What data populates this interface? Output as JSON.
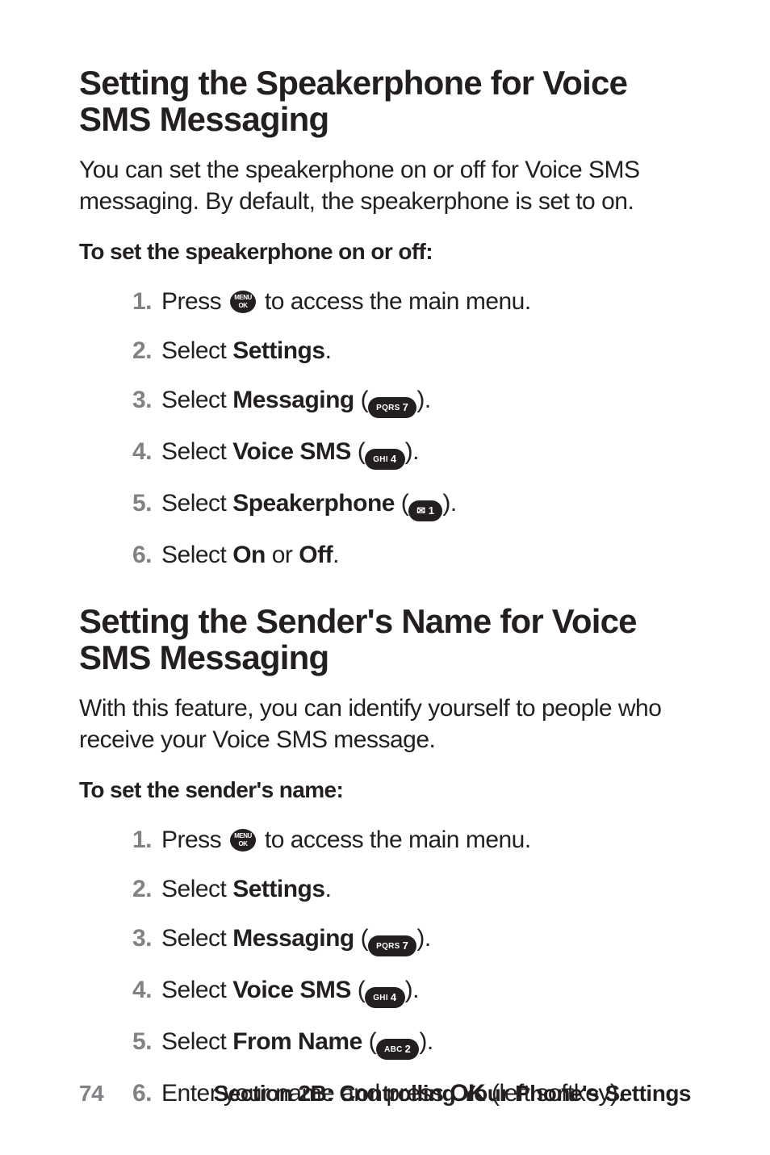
{
  "section1": {
    "heading": "Setting the Speakerphone for Voice SMS Messaging",
    "body": "You can set the speakerphone on or off for Voice SMS messaging. By default, the speakerphone is set to on.",
    "subhead": "To set the speakerphone on or off:",
    "steps": [
      {
        "num": "1.",
        "pre": "Press ",
        "post": " to access the main menu.",
        "icon": "menu-ok"
      },
      {
        "num": "2.",
        "pre": "Select ",
        "bold": "Settings",
        "post": "."
      },
      {
        "num": "3.",
        "pre": "Select ",
        "bold": "Messaging",
        "post1": " (",
        "keyLabelSmall": "PQRS",
        "keyLabel": "7",
        "post2": ")."
      },
      {
        "num": "4.",
        "pre": "Select ",
        "bold": "Voice SMS",
        "post1": " (",
        "keyLabelSmall": "GHI",
        "keyLabel": "4",
        "post2": ")."
      },
      {
        "num": "5.",
        "pre": "Select ",
        "bold": "Speakerphone",
        "post1": " (",
        "keySym": "✉",
        "keyLabel": "1",
        "post2": ")."
      },
      {
        "num": "6.",
        "pre": "Select ",
        "bold": "On",
        "mid": " or ",
        "bold2": "Off",
        "post": "."
      }
    ]
  },
  "section2": {
    "heading": "Setting the Sender's Name for Voice SMS Messaging",
    "body": "With this feature, you can identify yourself to people who receive your Voice SMS message.",
    "subhead": "To set the sender's name:",
    "steps": [
      {
        "num": "1.",
        "pre": "Press ",
        "post": " to access the main menu.",
        "icon": "menu-ok"
      },
      {
        "num": "2.",
        "pre": "Select ",
        "bold": "Settings",
        "post": "."
      },
      {
        "num": "3.",
        "pre": "Select ",
        "bold": "Messaging",
        "post1": " (",
        "keyLabelSmall": "PQRS",
        "keyLabel": "7",
        "post2": ")."
      },
      {
        "num": "4.",
        "pre": "Select ",
        "bold": "Voice SMS",
        "post1": " (",
        "keyLabelSmall": "GHI",
        "keyLabel": "4",
        "post2": ")."
      },
      {
        "num": "5.",
        "pre": "Select ",
        "bold": "From Name",
        "post1": " (",
        "keyLabelSmall": "ABC",
        "keyLabel": "2",
        "post2": ")."
      },
      {
        "num": "6.",
        "pre": "Enter your name and press ",
        "bold": "OK",
        "post": " (left softkey)."
      }
    ]
  },
  "footer": {
    "page": "74",
    "section": "Section 2B: Controlling Your Phone's Settings"
  },
  "icons": {
    "menuOkTop": "MENU",
    "menuOkBottom": "OK"
  }
}
